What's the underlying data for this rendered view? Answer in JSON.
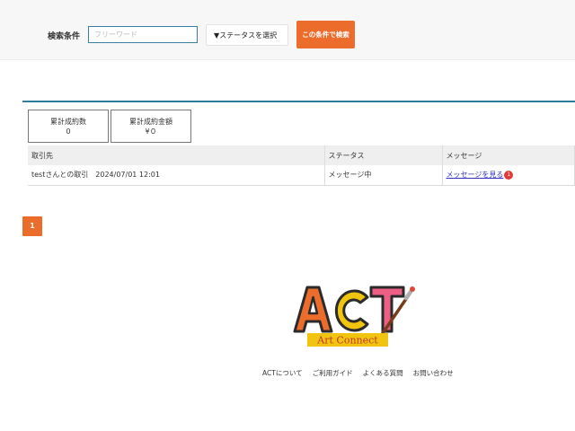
{
  "search": {
    "label": "検索条件",
    "placeholder": "フリーワード",
    "status_select": "▼ステータスを選択",
    "button": "この条件で検索"
  },
  "stats": {
    "count_label": "累計成約数",
    "count_value": "0",
    "amount_label": "累計成約金額",
    "amount_value": "¥０"
  },
  "table": {
    "headers": [
      "取引先",
      "ステータス",
      "メッセージ"
    ],
    "rows": [
      {
        "partner": "testさんとの取引　2024/07/01 12:01",
        "status": "メッセージ中",
        "message_link": "メッセージを見る",
        "badge": "1"
      }
    ]
  },
  "pagination": {
    "current": "1"
  },
  "logo": {
    "letters": "ACT",
    "tagline": "Art Connect"
  },
  "footer": {
    "links": [
      "ACTについて",
      "ご利用ガイド",
      "よくある質問",
      "お問い合わせ"
    ]
  },
  "colors": {
    "accent": "#ec6c2b",
    "divider": "#2f7d9c",
    "link": "#2f34c5",
    "badge": "#e33a3a"
  }
}
